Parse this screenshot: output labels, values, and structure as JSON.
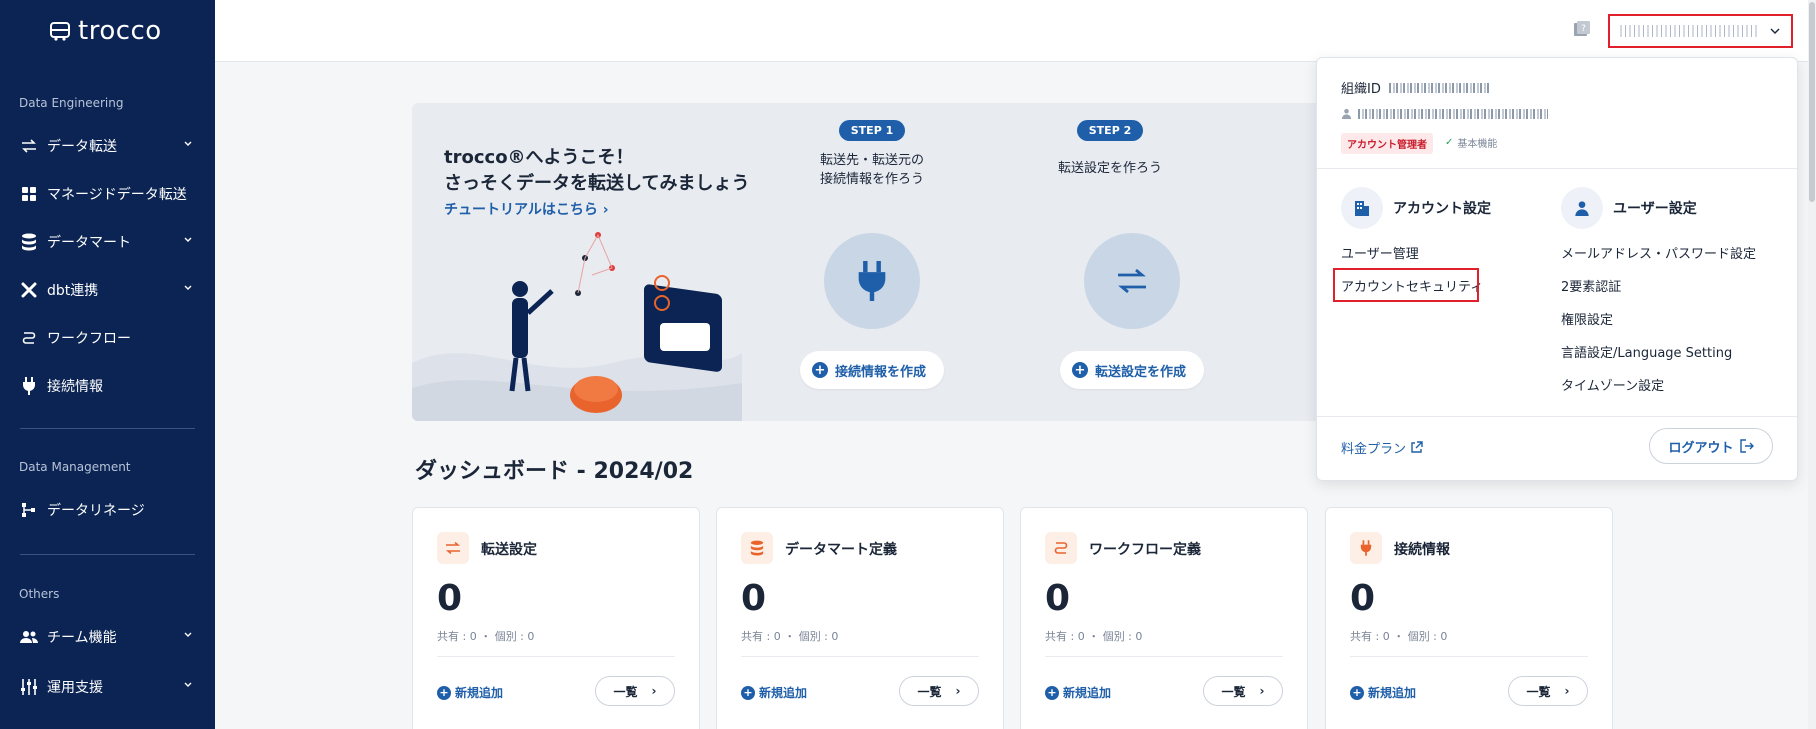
{
  "app": {
    "logo_text": "trocco"
  },
  "sidebar": {
    "sections": [
      "Data Engineering",
      "Data Management",
      "Others"
    ],
    "items": [
      {
        "label": "データ転送",
        "icon": "transfer-icon",
        "has_chevron": true
      },
      {
        "label": "マネージドデータ転送",
        "icon": "grid-icon",
        "has_chevron": false
      },
      {
        "label": "データマート",
        "icon": "database-icon",
        "has_chevron": true
      },
      {
        "label": "dbt連携",
        "icon": "dbt-icon",
        "has_chevron": true
      },
      {
        "label": "ワークフロー",
        "icon": "workflow-icon",
        "has_chevron": false
      },
      {
        "label": "接続情報",
        "icon": "plug-icon",
        "has_chevron": false
      },
      {
        "label": "データリネージ",
        "icon": "lineage-icon",
        "has_chevron": false
      },
      {
        "label": "チーム機能",
        "icon": "team-icon",
        "has_chevron": true
      },
      {
        "label": "運用支援",
        "icon": "ops-icon",
        "has_chevron": true
      }
    ]
  },
  "banner": {
    "title_line1": "trocco®へようこそ！",
    "title_line2": "さっそくデータを転送してみましょう",
    "tutorial_link": "チュートリアルはこちら ›",
    "step1": {
      "badge": "STEP 1",
      "text_line1": "転送先・転送元の",
      "text_line2": "接続情報を作ろう",
      "button": "接続情報を作成"
    },
    "step2": {
      "badge": "STEP 2",
      "text_line1": "転送設定を作ろう",
      "button": "転送設定を作成"
    }
  },
  "dashboard": {
    "title": "ダッシュボード - 2024/02",
    "cards": [
      {
        "title": "転送設定",
        "count": "0",
        "sub": "共有 : 0 ・ 個別 : 0",
        "add": "新規追加",
        "list": "一覧",
        "icon": "transfer-icon"
      },
      {
        "title": "データマート定義",
        "count": "0",
        "sub": "共有 : 0 ・ 個別 : 0",
        "add": "新規追加",
        "list": "一覧",
        "icon": "database-icon"
      },
      {
        "title": "ワークフロー定義",
        "count": "0",
        "sub": "共有 : 0 ・ 個別 : 0",
        "add": "新規追加",
        "list": "一覧",
        "icon": "workflow-icon"
      },
      {
        "title": "接続情報",
        "count": "0",
        "sub": "共有 : 0 ・ 個別 : 0",
        "add": "新規追加",
        "list": "一覧",
        "icon": "plug-icon"
      }
    ]
  },
  "dropdown": {
    "org_label": "組織ID",
    "role_badge": "アカウント管理者",
    "basic_label": "基本機能",
    "account_settings": {
      "heading": "アカウント設定",
      "links": [
        "ユーザー管理",
        "アカウントセキュリティ"
      ]
    },
    "user_settings": {
      "heading": "ユーザー設定",
      "links": [
        "メールアドレス・パスワード設定",
        "2要素認証",
        "権限設定",
        "言語設定/Language Setting",
        "タイムゾーン設定"
      ]
    },
    "plan_link": "料金プラン",
    "logout": "ログアウト"
  },
  "colors": {
    "sidebar": "#0b2453",
    "accent": "#1f5fa9",
    "highlight": "#e0202a",
    "card_icon": "#e8642c"
  }
}
